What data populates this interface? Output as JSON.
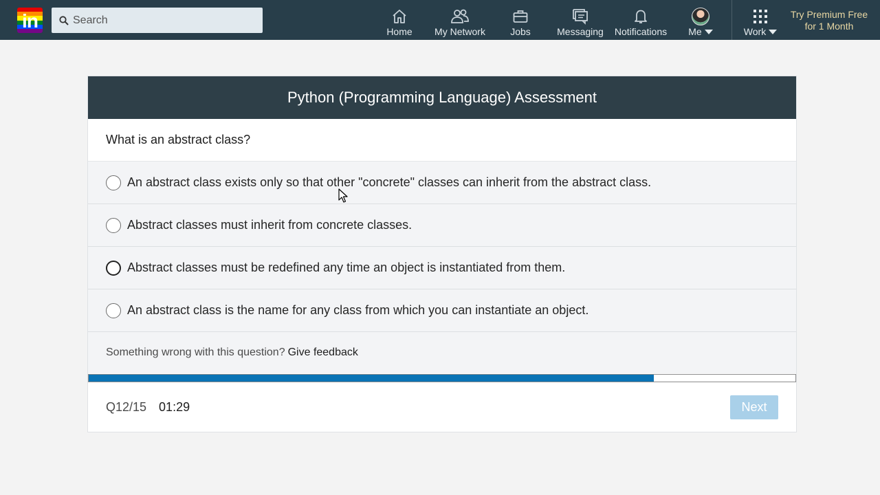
{
  "nav": {
    "logo_text": "in",
    "search_placeholder": "Search",
    "items": [
      {
        "label": "Home",
        "icon": "home-icon"
      },
      {
        "label": "My Network",
        "icon": "people-icon"
      },
      {
        "label": "Jobs",
        "icon": "briefcase-icon"
      },
      {
        "label": "Messaging",
        "icon": "chat-icon"
      },
      {
        "label": "Notifications",
        "icon": "bell-icon"
      },
      {
        "label": "Me",
        "icon": "avatar"
      },
      {
        "label": "Work",
        "icon": "grid-icon"
      }
    ],
    "premium_line1": "Try Premium Free",
    "premium_line2": "for 1 Month"
  },
  "assessment": {
    "title": "Python (Programming Language) Assessment",
    "question": "What is an abstract class?",
    "options": [
      "An abstract class exists only so that other \"concrete\" classes can inherit from the abstract class.",
      "Abstract classes must inherit from concrete classes.",
      "Abstract classes must be redefined any time an object is instantiated from them.",
      "An abstract class is the name for any class from which you can instantiate an object."
    ],
    "feedback_prompt": "Something wrong with this question?",
    "feedback_link": "Give feedback",
    "progress_fraction": 0.8,
    "question_counter": "Q12/15",
    "timer": "01:29",
    "next_label": "Next"
  },
  "colors": {
    "nav_bg": "#283e4a",
    "header_bg": "#2e3f48",
    "progress_fill": "#0a73b5",
    "next_disabled": "#a9d0e9",
    "premium_text": "#e8d7a3"
  }
}
